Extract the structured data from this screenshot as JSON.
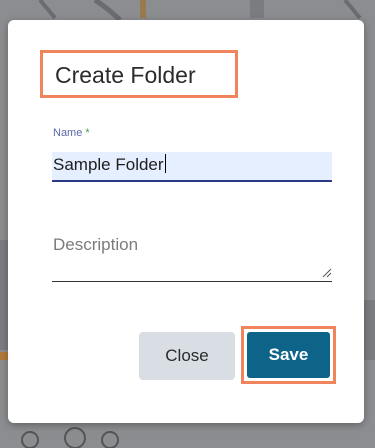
{
  "dialog": {
    "title": "Create Folder",
    "name_label": "Name",
    "name_required_mark": "*",
    "name_value": "Sample Folder",
    "description_placeholder": "Description",
    "close_label": "Close",
    "save_label": "Save"
  },
  "colors": {
    "primary": "#0d6388",
    "highlight": "#f0845c",
    "input_focus_bg": "#e6efff",
    "input_underline": "#2a3a85",
    "label": "#5c6aa8",
    "required": "#3ea24b",
    "secondary_button": "#d9dee5"
  }
}
